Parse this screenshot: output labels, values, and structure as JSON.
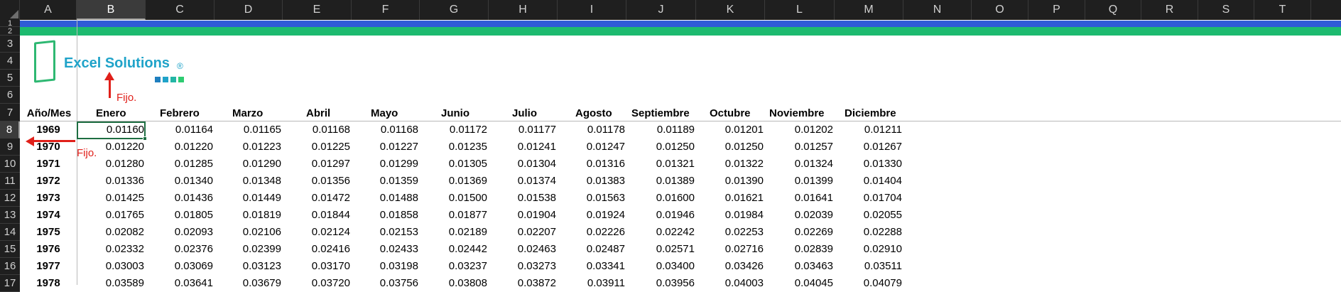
{
  "columns": [
    "A",
    "B",
    "C",
    "D",
    "E",
    "F",
    "G",
    "H",
    "I",
    "J",
    "K",
    "L",
    "M",
    "N",
    "O",
    "P",
    "Q",
    "R",
    "S",
    "T"
  ],
  "selected_column": "B",
  "rows": [
    "1",
    "2",
    "3",
    "4",
    "5",
    "6",
    "7",
    "8",
    "9",
    "10",
    "11",
    "12",
    "13",
    "14",
    "15",
    "16",
    "17"
  ],
  "selected_row": "8",
  "banner_colors": {
    "blue": "#2f5bd6",
    "green": "#1dba6f"
  },
  "logo": {
    "text": "Excel Solutions",
    "reg_mark": "®",
    "colors": [
      "#1f7fbf",
      "#1fa3c9",
      "#23b6a5",
      "#2ecc71"
    ]
  },
  "annotations": {
    "col_fixed": "Fijo.",
    "row_fixed": "Fijo."
  },
  "header_row": {
    "year_month": "Año/Mes",
    "months": [
      "Enero",
      "Febrero",
      "Marzo",
      "Abril",
      "Mayo",
      "Junio",
      "Julio",
      "Agosto",
      "Septiembre",
      "Octubre",
      "Noviembre",
      "Diciembre"
    ]
  },
  "table": [
    {
      "year": "1969",
      "values": [
        "0.01160",
        "0.01164",
        "0.01165",
        "0.01168",
        "0.01168",
        "0.01172",
        "0.01177",
        "0.01178",
        "0.01189",
        "0.01201",
        "0.01202",
        "0.01211"
      ]
    },
    {
      "year": "1970",
      "values": [
        "0.01220",
        "0.01220",
        "0.01223",
        "0.01225",
        "0.01227",
        "0.01235",
        "0.01241",
        "0.01247",
        "0.01250",
        "0.01250",
        "0.01257",
        "0.01267"
      ]
    },
    {
      "year": "1971",
      "values": [
        "0.01280",
        "0.01285",
        "0.01290",
        "0.01297",
        "0.01299",
        "0.01305",
        "0.01304",
        "0.01316",
        "0.01321",
        "0.01322",
        "0.01324",
        "0.01330"
      ]
    },
    {
      "year": "1972",
      "values": [
        "0.01336",
        "0.01340",
        "0.01348",
        "0.01356",
        "0.01359",
        "0.01369",
        "0.01374",
        "0.01383",
        "0.01389",
        "0.01390",
        "0.01399",
        "0.01404"
      ]
    },
    {
      "year": "1973",
      "values": [
        "0.01425",
        "0.01436",
        "0.01449",
        "0.01472",
        "0.01488",
        "0.01500",
        "0.01538",
        "0.01563",
        "0.01600",
        "0.01621",
        "0.01641",
        "0.01704"
      ]
    },
    {
      "year": "1974",
      "values": [
        "0.01765",
        "0.01805",
        "0.01819",
        "0.01844",
        "0.01858",
        "0.01877",
        "0.01904",
        "0.01924",
        "0.01946",
        "0.01984",
        "0.02039",
        "0.02055"
      ]
    },
    {
      "year": "1975",
      "values": [
        "0.02082",
        "0.02093",
        "0.02106",
        "0.02124",
        "0.02153",
        "0.02189",
        "0.02207",
        "0.02226",
        "0.02242",
        "0.02253",
        "0.02269",
        "0.02288"
      ]
    },
    {
      "year": "1976",
      "values": [
        "0.02332",
        "0.02376",
        "0.02399",
        "0.02416",
        "0.02433",
        "0.02442",
        "0.02463",
        "0.02487",
        "0.02571",
        "0.02716",
        "0.02839",
        "0.02910"
      ]
    },
    {
      "year": "1977",
      "values": [
        "0.03003",
        "0.03069",
        "0.03123",
        "0.03170",
        "0.03198",
        "0.03237",
        "0.03273",
        "0.03341",
        "0.03400",
        "0.03426",
        "0.03463",
        "0.03511"
      ]
    },
    {
      "year": "1978",
      "values": [
        "0.03589",
        "0.03641",
        "0.03679",
        "0.03720",
        "0.03756",
        "0.03808",
        "0.03872",
        "0.03911",
        "0.03956",
        "0.04003",
        "0.04045",
        "0.04079"
      ]
    }
  ]
}
